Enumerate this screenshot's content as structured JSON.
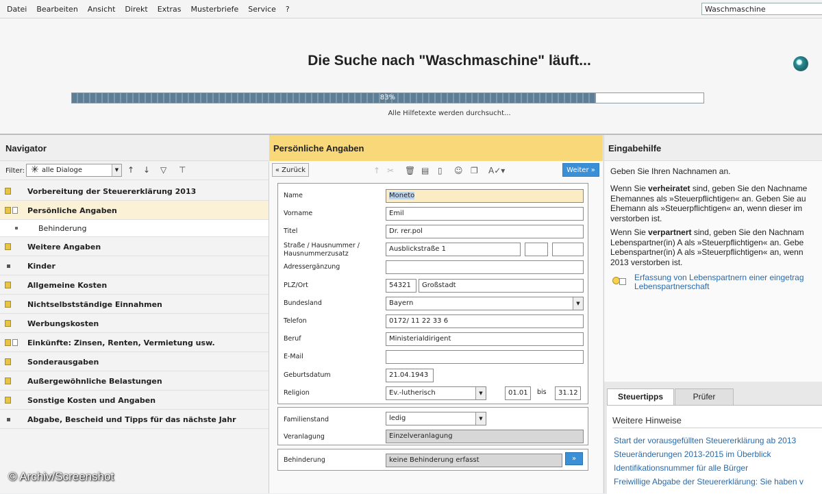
{
  "menu": [
    "Datei",
    "Bearbeiten",
    "Ansicht",
    "Direkt",
    "Extras",
    "Musterbriefe",
    "Service",
    "?"
  ],
  "top_search": "Waschmaschine",
  "search": {
    "title": "Die Suche nach \"Waschmaschine\" läuft...",
    "progress_label": "83%",
    "progress": 0.83,
    "subtitle": "Alle Hilfetexte werden durchsucht..."
  },
  "navigator": {
    "title": "Navigator",
    "filter_label": "Filter:",
    "filter_value": "alle Dialoge",
    "items": [
      {
        "label": "Vorbereitung der Steuererklärung 2013"
      },
      {
        "label": "Persönliche Angaben"
      },
      {
        "label": "Behinderung"
      },
      {
        "label": "Weitere Angaben"
      },
      {
        "label": "Kinder"
      },
      {
        "label": "Allgemeine Kosten"
      },
      {
        "label": "Nichtselbstständige Einnahmen"
      },
      {
        "label": "Werbungskosten"
      },
      {
        "label": "Einkünfte: Zinsen, Renten, Vermietung usw."
      },
      {
        "label": "Sonderausgaben"
      },
      {
        "label": "Außergewöhnliche Belastungen"
      },
      {
        "label": "Sonstige Kosten und Angaben"
      },
      {
        "label": "Abgabe, Bescheid und Tipps für das nächste Jahr"
      }
    ]
  },
  "form": {
    "title": "Persönliche Angaben",
    "back": "« Zurück",
    "next": "Weiter »",
    "labels": {
      "name": "Name",
      "vorname": "Vorname",
      "titel": "Titel",
      "strasse_1": "Straße / Hausnummer /",
      "strasse_2": "Hausnummerzusatz",
      "adresse": "Adressergänzung",
      "plz": "PLZ/Ort",
      "bundesland": "Bundesland",
      "telefon": "Telefon",
      "beruf": "Beruf",
      "email": "E-Mail",
      "geburtsdatum": "Geburtsdatum",
      "religion": "Religion",
      "bis": "bis",
      "familienstand": "Familienstand",
      "veranlagung": "Veranlagung",
      "behinderung": "Behinderung"
    },
    "values": {
      "name": "Moneto",
      "vorname": "Emil",
      "titel": "Dr. rer.pol",
      "strasse": "Ausblickstraße 1",
      "hausnummer": "",
      "zusatz": "",
      "adresse": "",
      "plz": "54321",
      "ort": "Großstadt",
      "bundesland": "Bayern",
      "telefon": "0172/ 11 22 33 6",
      "beruf": "Ministerialdirigent",
      "email": "",
      "geburtsdatum": "21.04.1943",
      "religion": "Ev.-lutherisch",
      "religion_von": "01.01",
      "religion_bis": "31.12",
      "familienstand": "ledig",
      "veranlagung": "Einzelveranlagung",
      "behinderung": "keine Behinderung erfasst",
      "behinderung_btn": "»"
    }
  },
  "help": {
    "title": "Eingabehilfe",
    "p1": "Geben Sie Ihren Nachnamen an.",
    "p2_lines": [
      "Wenn Sie ",
      "verheiratet",
      " sind, geben Sie den Nachname",
      "Ehemannes als »Steuerpflichtigen« an. Geben Sie au",
      "Ehemann als »Steuerpflichtigen« an, wenn dieser im",
      "verstorben ist."
    ],
    "p3_lines": [
      "Wenn Sie ",
      "verpartnert",
      " sind, geben Sie den Nachnam",
      "Lebenspartner(in) A als »Steuerpflichtigen« an. Gebe",
      "Lebenspartner(in) A als »Steuerpflichtigen« an, wenn",
      "2013 verstorben ist."
    ],
    "link_1": "Erfassung von Lebenspartnern einer eingetrag",
    "link_2": "Lebenspartnerschaft"
  },
  "tips": {
    "tabs": [
      "Steuertipps",
      "Prüfer"
    ],
    "heading": "Weitere Hinweise",
    "links": [
      "Start der vorausgefüllten Steuererklärung ab 2013",
      "Steueränderungen 2013-2015 im Überblick",
      "Identifikationsnummer für alle Bürger",
      "Freiwillige Abgabe der Steuererklärung: Sie haben v"
    ]
  },
  "watermark": "© Archiv/Screenshot"
}
